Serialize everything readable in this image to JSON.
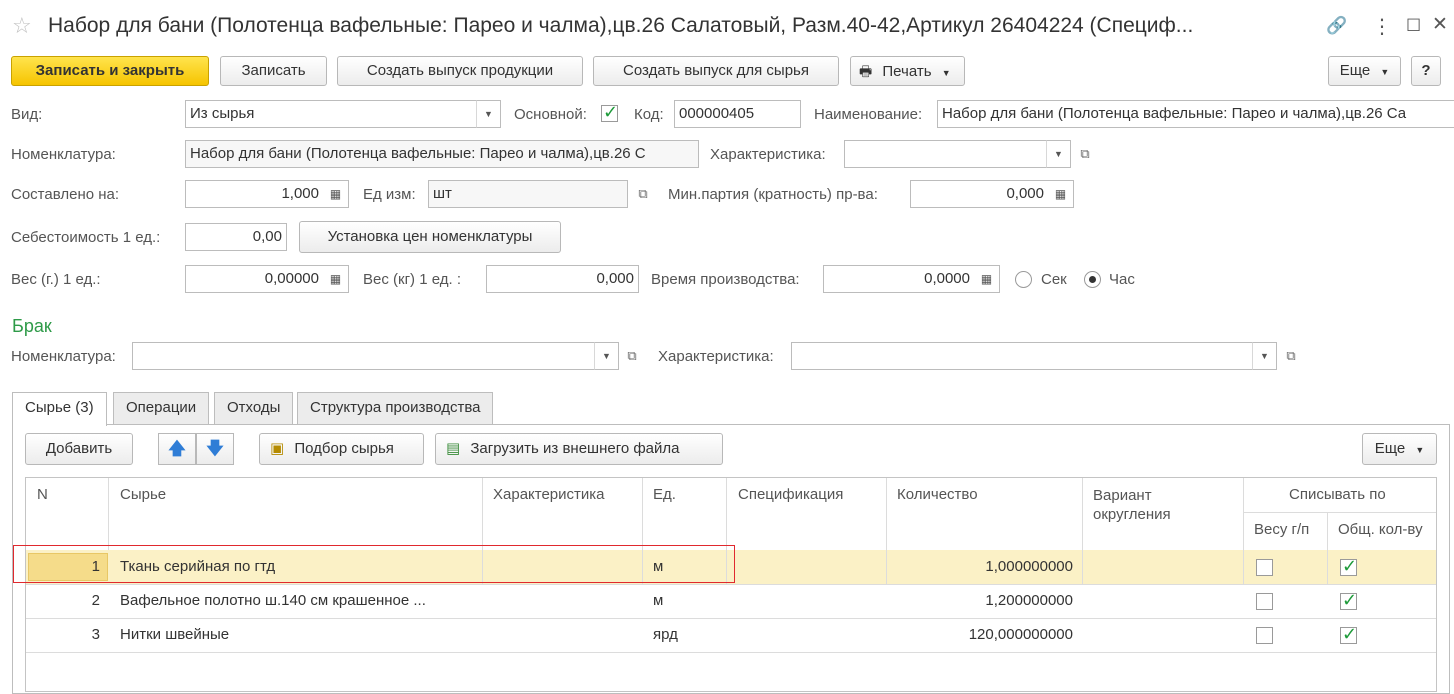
{
  "window": {
    "title": "Набор для бани (Полотенца вафельные: Парео и чалма),цв.26 Салатовый, Разм.40-42,Артикул 26404224 (Специф..."
  },
  "toolbar": {
    "save_close": "Записать и закрыть",
    "save": "Записать",
    "create_product_release": "Создать выпуск продукции",
    "create_raw_release": "Создать выпуск для сырья",
    "print": "Печать",
    "more": "Еще"
  },
  "form": {
    "vid_label": "Вид:",
    "vid_value": "Из сырья",
    "osnovnoy_label": "Основной:",
    "osnovnoy_checked": true,
    "kod_label": "Код:",
    "kod_value": "000000405",
    "naim_label": "Наименование:",
    "naim_value": "Набор для бани (Полотенца вафельные: Парео и чалма),цв.26 Са",
    "nomenkl_label": "Номенклатура:",
    "nomenkl_value": "Набор для бани (Полотенца вафельные: Парео и чалма),цв.26 С",
    "harakt_label": "Характеристика:",
    "harakt_value": "",
    "sostavleno_label": "Составлено на:",
    "sostavleno_value": "1,000",
    "ed_label": "Ед изм:",
    "ed_value": "шт",
    "min_partiya_label": "Мин.партия (кратность) пр-ва:",
    "min_partiya_value": "0,000",
    "sebest_label": "Себестоимость 1 ед.:",
    "sebest_value": "0,00",
    "ustanovka_button": "Установка цен номенклатуры",
    "ves_g_label": "Вес (г.)  1 ед.:",
    "ves_g_value": "0,00000",
    "ves_kg_label": "Вес (кг) 1 ед.   :",
    "ves_kg_value": "0,000",
    "vremya_label": "Время производства:",
    "vremya_value": "0,0000",
    "sek_label": "Сек",
    "chas_label": "Час"
  },
  "brak": {
    "title": "Брак",
    "nomenkl_label": "Номенклатура:",
    "nomenkl_value": "",
    "harakt_label": "Характеристика:",
    "harakt_value": ""
  },
  "tabs": [
    {
      "label": "Сырье (3)"
    },
    {
      "label": "Операции"
    },
    {
      "label": "Отходы"
    },
    {
      "label": "Структура производства"
    }
  ],
  "tab_toolbar": {
    "add": "Добавить",
    "podbor": "Подбор сырья",
    "load": "Загрузить из внешнего файла",
    "more": "Еще"
  },
  "table": {
    "headers": {
      "n": "N",
      "syrye": "Сырье",
      "harakt": "Характеристика",
      "ed": "Ед.",
      "spec": "Спецификация",
      "kol": "Количество",
      "variant": "Вариант округления",
      "spisyvat": "Списывать по",
      "vesu": "Весу г/п",
      "obsh": "Общ. кол-ву"
    },
    "rows": [
      {
        "n": "1",
        "syrye": "Ткань серийная по гтд",
        "harakt": "",
        "ed": "м",
        "spec": "",
        "kol": "1,000000000",
        "variant": "",
        "vesu": false,
        "obsh": true
      },
      {
        "n": "2",
        "syrye": "Вафельное полотно ш.140 см крашенное ...",
        "harakt": "",
        "ed": "м",
        "spec": "",
        "kol": "1,200000000",
        "variant": "",
        "vesu": false,
        "obsh": true
      },
      {
        "n": "3",
        "syrye": "Нитки швейные",
        "harakt": "",
        "ed": "ярд",
        "spec": "",
        "kol": "120,000000000",
        "variant": "",
        "vesu": false,
        "obsh": true
      }
    ]
  }
}
